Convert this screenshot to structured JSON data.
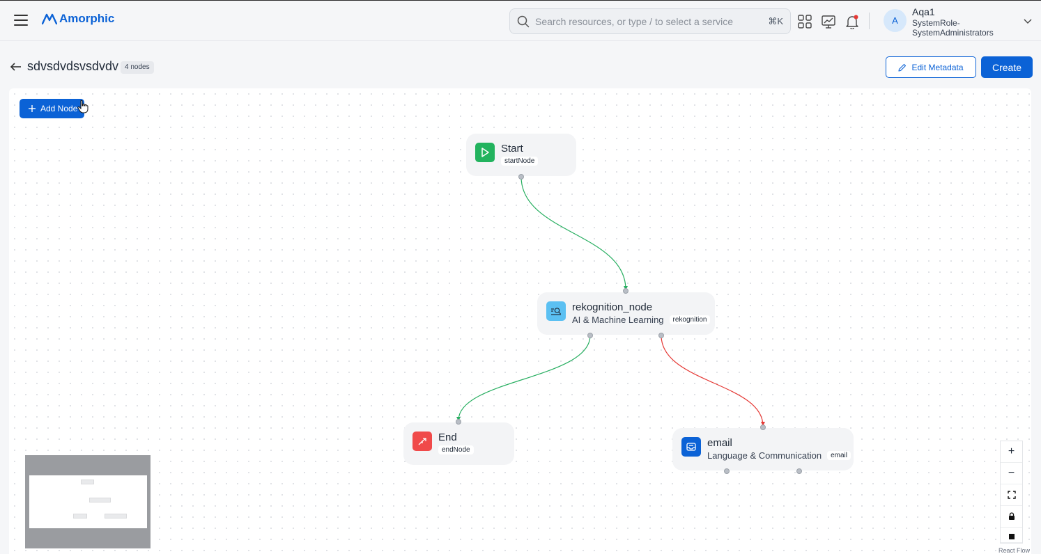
{
  "app": {
    "logo_text": "Amorphic",
    "brand_color": "#0b62d6"
  },
  "search": {
    "placeholder": "Search resources, or type / to select a service",
    "shortcut": "⌘K"
  },
  "user": {
    "initial": "A",
    "name": "Aqa1",
    "role": "SystemRole-SystemAdministrators"
  },
  "header_icons": [
    "apps-grid-icon",
    "monitor-chart-icon",
    "bell-icon"
  ],
  "page": {
    "title": "sdvsdvdsvsdvdv",
    "node_count": "4 nodes",
    "edit_metadata_label": "Edit Metadata",
    "create_label": "Create"
  },
  "canvas": {
    "add_node_label": "Add Node",
    "attribution": "React Flow",
    "nodes": [
      {
        "title": "Start",
        "subtitle": "",
        "chip": "startNode",
        "icon": "play-icon",
        "color": "#22b35e"
      },
      {
        "title": "rekognition_node",
        "subtitle": "AI & Machine Learning",
        "chip": "rekognition",
        "icon": "image-search-icon",
        "color": "#5bc0f2"
      },
      {
        "title": "End",
        "subtitle": "",
        "chip": "endNode",
        "icon": "exit-icon",
        "color": "#f04a4a"
      },
      {
        "title": "email",
        "subtitle": "Language & Communication",
        "chip": "email",
        "icon": "inbox-icon",
        "color": "#0b62d6"
      }
    ],
    "edges": [
      {
        "from": "Start",
        "to": "rekognition_node",
        "color": "#27ae60"
      },
      {
        "from": "rekognition_node",
        "to": "End",
        "color": "#27ae60"
      },
      {
        "from": "rekognition_node",
        "to": "email",
        "color": "#e53935"
      }
    ]
  },
  "controls": {
    "zoom_in": "+",
    "zoom_out": "−"
  }
}
